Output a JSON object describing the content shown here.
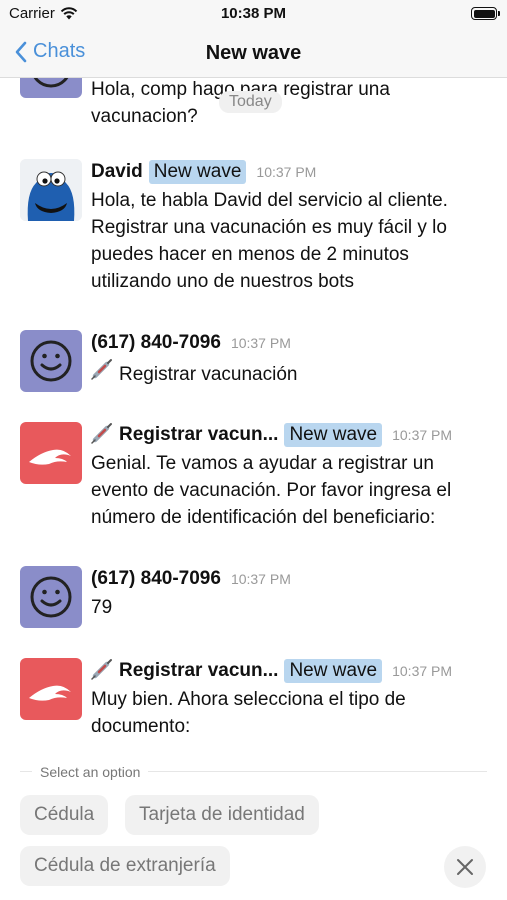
{
  "status_bar": {
    "carrier": "Carrier",
    "time": "10:38 PM",
    "battery_level": 1.0
  },
  "nav": {
    "back_label": "Chats",
    "title": "New wave"
  },
  "chat": {
    "partial_message": "Hola, comp hago para registrar una vacunacion?",
    "date_separator": "Today",
    "messages": [
      {
        "sender": "David",
        "tag": "New wave",
        "time": "10:37 PM",
        "avatar": "cookie-monster-avatar",
        "text": "Hola, te habla David del servicio al cliente. Registrar una vacunación es muy fácil y lo puedes hacer en menos de 2 minutos utilizando uno de nuestros bots"
      },
      {
        "sender": "(617) 840-7096",
        "time": "10:37 PM",
        "avatar": "smiley-avatar",
        "icon": "syringe-icon",
        "text": "Registrar vacunación"
      },
      {
        "sender": "Registrar vacun...",
        "sender_icon": "syringe-icon",
        "tag": "New wave",
        "time": "10:37 PM",
        "avatar": "wave-logo-avatar",
        "text": "Genial.  Te vamos a ayudar a registrar un evento de vacunación.  Por favor ingresa el número de identificación del beneficiario:"
      },
      {
        "sender": "(617) 840-7096",
        "time": "10:37 PM",
        "avatar": "smiley-avatar",
        "text": "79"
      },
      {
        "sender": "Registrar vacun...",
        "sender_icon": "syringe-icon",
        "tag": "New wave",
        "time": "10:37 PM",
        "avatar": "wave-logo-avatar",
        "text": "Muy bien.  Ahora selecciona el tipo de documento:"
      }
    ]
  },
  "options": {
    "label": "Select an option",
    "choices": [
      "Cédula",
      "Tarjeta de identidad",
      "Cédula de extranjería"
    ],
    "close_icon": "close-icon"
  },
  "colors": {
    "accent": "#4a90d9",
    "tag_bg": "#b9d6ef",
    "user_avatar": "#8a8dc9",
    "bot_avatar": "#e8595c"
  }
}
